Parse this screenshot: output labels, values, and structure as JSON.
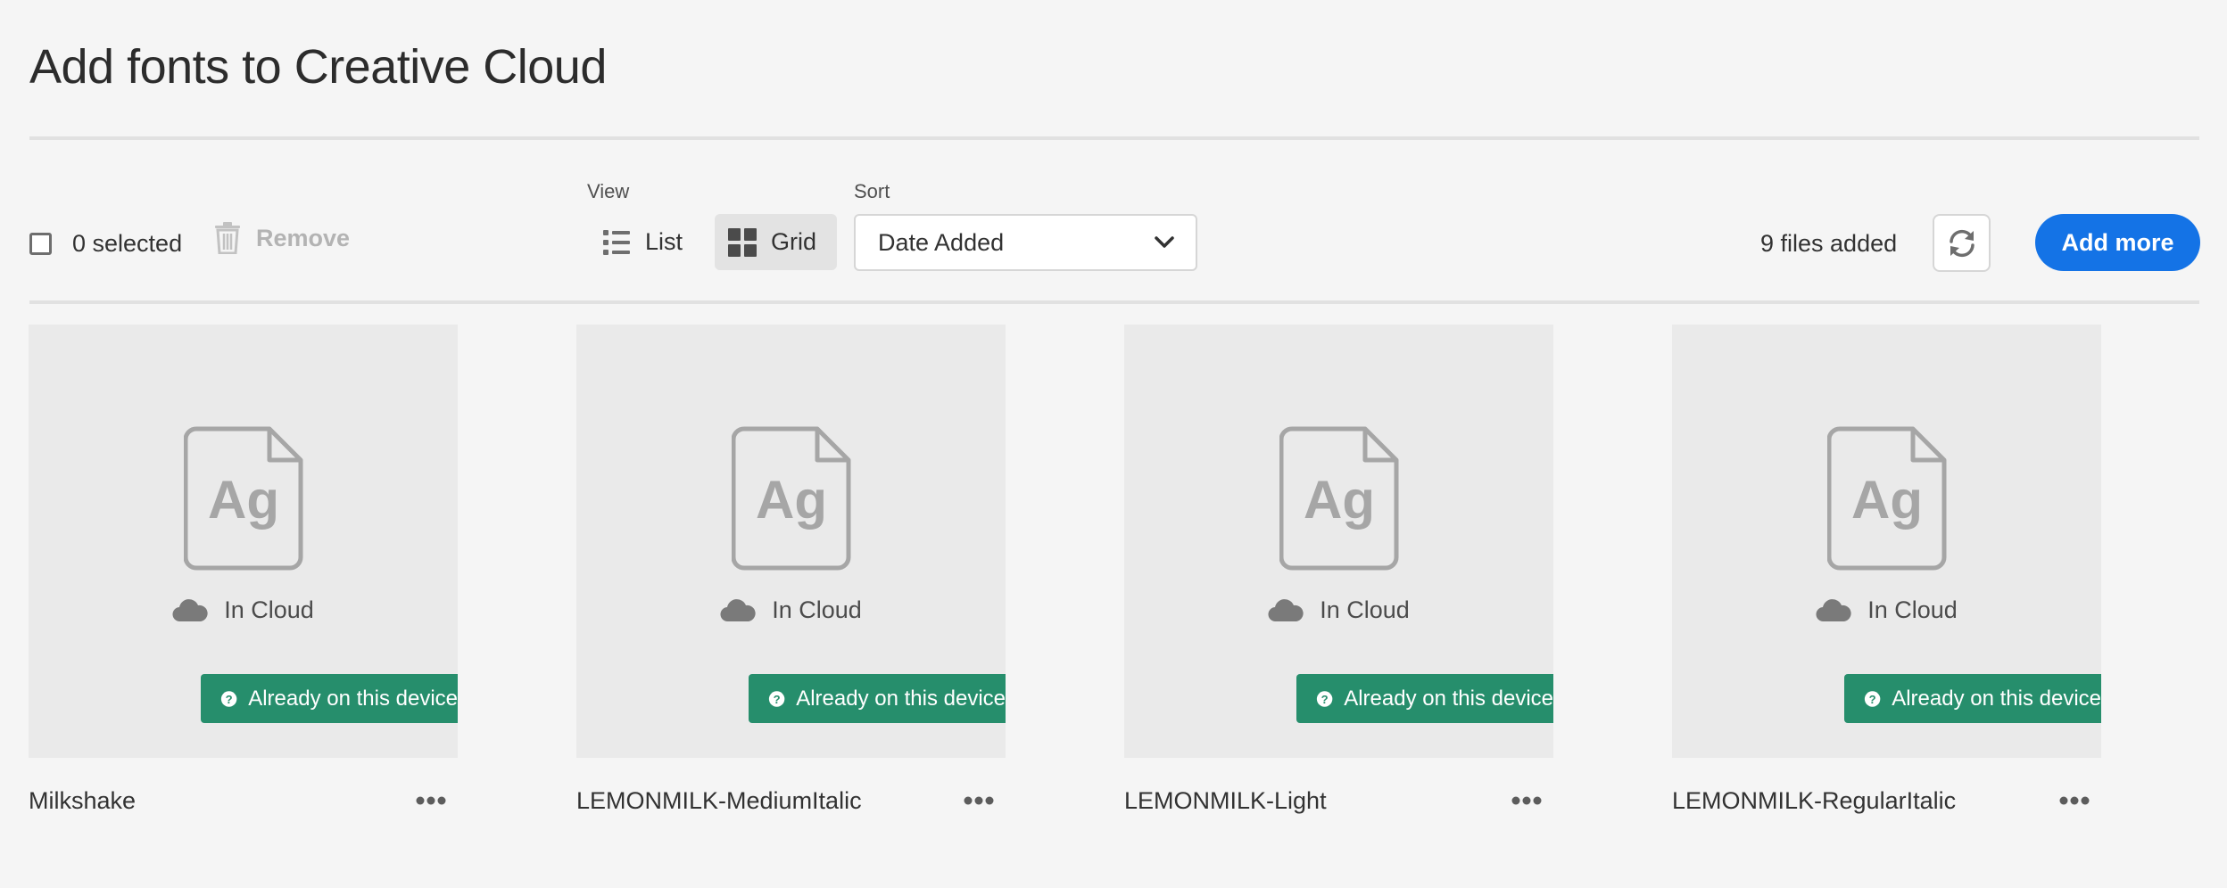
{
  "page": {
    "title": "Add fonts to Creative Cloud"
  },
  "toolbar": {
    "selected_count": "0 selected",
    "remove_label": "Remove",
    "view_label": "View",
    "view_list_label": "List",
    "view_grid_label": "Grid",
    "active_view": "Grid",
    "sort_label": "Sort",
    "sort_value": "Date Added",
    "files_added": "9 files added",
    "add_more_label": "Add more"
  },
  "icons": {
    "checkbox": "checkbox-icon",
    "remove": "trash-icon",
    "list": "list-icon",
    "grid": "grid-icon",
    "dropdown": "chevron-down-icon",
    "refresh": "refresh-icon",
    "file": "font-file-icon",
    "cloud": "cloud-icon",
    "badge": "help-circle-icon",
    "more": "more-icon"
  },
  "colors": {
    "accent": "#1473e6",
    "badge": "#268e6c",
    "background": "#f5f5f5",
    "card_background": "#eaeaea"
  },
  "cards": [
    {
      "name": "Milkshake",
      "preview_glyph": "Ag",
      "status": "In Cloud",
      "badge": "Already on this device"
    },
    {
      "name": "LEMONMILK-MediumItalic",
      "preview_glyph": "Ag",
      "status": "In Cloud",
      "badge": "Already on this device"
    },
    {
      "name": "LEMONMILK-Light",
      "preview_glyph": "Ag",
      "status": "In Cloud",
      "badge": "Already on this device"
    },
    {
      "name": "LEMONMILK-RegularItalic",
      "preview_glyph": "Ag",
      "status": "In Cloud",
      "badge": "Already on this device"
    }
  ]
}
